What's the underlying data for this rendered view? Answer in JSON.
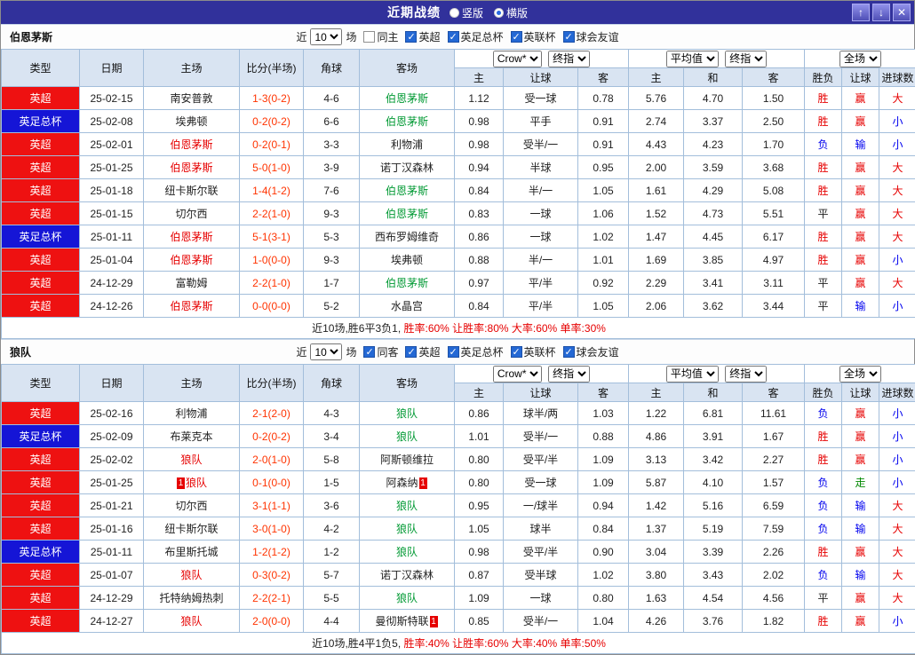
{
  "colors": {
    "topbar_bg": "#31319b",
    "header_cell_bg": "#d9e4f2",
    "grid_line": "#a3bedb",
    "league_epl_bg": "#ee1111",
    "league_facup_bg": "#1515d6",
    "score_text": "#ff3300",
    "win_text": "#e60000",
    "loss_text": "#0000ee",
    "push_text": "#008800",
    "focus_home": "#e60000",
    "focus_away": "#009933",
    "stat_red": "#e60000",
    "checkbox_blue": "#2468d4"
  },
  "topbar": {
    "title": "近期战绩",
    "vertical_label": "竖版",
    "horizontal_label": "横版",
    "selected_layout": "横版",
    "up_button": "↑",
    "down_button": "↓",
    "close_button": "✕"
  },
  "table_header": {
    "col_type": "类型",
    "col_date": "日期",
    "col_home": "主场",
    "col_score": "比分(半场)",
    "col_corner": "角球",
    "col_away": "客场",
    "sub_home": "主",
    "sub_handicap": "让球",
    "sub_away": "客",
    "sub_avg_home": "主",
    "sub_avg_draw": "和",
    "sub_avg_away": "客",
    "sub_result": "胜负",
    "sub_let": "让球",
    "sub_goals": "进球数",
    "dd_company": "Crow*",
    "dd_final1": "终指",
    "dd_avg": "平均值",
    "dd_final2": "终指",
    "dd_scope": "全场"
  },
  "sections": [
    {
      "team": "伯恩茅斯",
      "filter": {
        "near": "近",
        "count": "10",
        "unit": "场",
        "same_venue_label": "同主",
        "same_venue_checked": false,
        "leagues": [
          "英超",
          "英足总杯",
          "英联杯",
          "球会友谊"
        ]
      },
      "rows": [
        {
          "league": "英超",
          "date": "25-02-15",
          "home": "南安普敦",
          "score": "1-3(0-2)",
          "corner": "4-6",
          "away": "伯恩茅斯",
          "focus": "away",
          "odds": [
            "1.12",
            "受一球",
            "0.78"
          ],
          "avg": [
            "5.76",
            "4.70",
            "1.50"
          ],
          "result": "胜",
          "handicap": "赢",
          "goals": "大"
        },
        {
          "league": "英足总杯",
          "date": "25-02-08",
          "home": "埃弗顿",
          "score": "0-2(0-2)",
          "corner": "6-6",
          "away": "伯恩茅斯",
          "focus": "away",
          "odds": [
            "0.98",
            "平手",
            "0.91"
          ],
          "avg": [
            "2.74",
            "3.37",
            "2.50"
          ],
          "result": "胜",
          "handicap": "赢",
          "goals": "小"
        },
        {
          "league": "英超",
          "date": "25-02-01",
          "home": "伯恩茅斯",
          "focus": "home",
          "score": "0-2(0-1)",
          "corner": "3-3",
          "away": "利物浦",
          "odds": [
            "0.98",
            "受半/一",
            "0.91"
          ],
          "avg": [
            "4.43",
            "4.23",
            "1.70"
          ],
          "result": "负",
          "handicap": "输",
          "goals": "小"
        },
        {
          "league": "英超",
          "date": "25-01-25",
          "home": "伯恩茅斯",
          "focus": "home",
          "score": "5-0(1-0)",
          "corner": "3-9",
          "away": "诺丁汉森林",
          "odds": [
            "0.94",
            "半球",
            "0.95"
          ],
          "avg": [
            "2.00",
            "3.59",
            "3.68"
          ],
          "result": "胜",
          "handicap": "赢",
          "goals": "大"
        },
        {
          "league": "英超",
          "date": "25-01-18",
          "home": "纽卡斯尔联",
          "score": "1-4(1-2)",
          "corner": "7-6",
          "away": "伯恩茅斯",
          "focus": "away",
          "odds": [
            "0.84",
            "半/一",
            "1.05"
          ],
          "avg": [
            "1.61",
            "4.29",
            "5.08"
          ],
          "result": "胜",
          "handicap": "赢",
          "goals": "大"
        },
        {
          "league": "英超",
          "date": "25-01-15",
          "home": "切尔西",
          "score": "2-2(1-0)",
          "corner": "9-3",
          "away": "伯恩茅斯",
          "focus": "away",
          "odds": [
            "0.83",
            "一球",
            "1.06"
          ],
          "avg": [
            "1.52",
            "4.73",
            "5.51"
          ],
          "result": "平",
          "handicap": "赢",
          "goals": "大"
        },
        {
          "league": "英足总杯",
          "date": "25-01-11",
          "home": "伯恩茅斯",
          "focus": "home",
          "score": "5-1(3-1)",
          "corner": "5-3",
          "away": "西布罗姆维奇",
          "odds": [
            "0.86",
            "一球",
            "1.02"
          ],
          "avg": [
            "1.47",
            "4.45",
            "6.17"
          ],
          "result": "胜",
          "handicap": "赢",
          "goals": "大"
        },
        {
          "league": "英超",
          "date": "25-01-04",
          "home": "伯恩茅斯",
          "focus": "home",
          "score": "1-0(0-0)",
          "corner": "9-3",
          "away": "埃弗顿",
          "odds": [
            "0.88",
            "半/一",
            "1.01"
          ],
          "avg": [
            "1.69",
            "3.85",
            "4.97"
          ],
          "result": "胜",
          "handicap": "赢",
          "goals": "小"
        },
        {
          "league": "英超",
          "date": "24-12-29",
          "home": "富勒姆",
          "score": "2-2(1-0)",
          "corner": "1-7",
          "away": "伯恩茅斯",
          "focus": "away",
          "odds": [
            "0.97",
            "平/半",
            "0.92"
          ],
          "avg": [
            "2.29",
            "3.41",
            "3.11"
          ],
          "result": "平",
          "handicap": "赢",
          "goals": "大"
        },
        {
          "league": "英超",
          "date": "24-12-26",
          "home": "伯恩茅斯",
          "focus": "home",
          "score": "0-0(0-0)",
          "corner": "5-2",
          "away": "水晶宫",
          "odds": [
            "0.84",
            "平/半",
            "1.05"
          ],
          "avg": [
            "2.06",
            "3.62",
            "3.44"
          ],
          "result": "平",
          "handicap": "输",
          "goals": "小"
        }
      ],
      "summary": {
        "prefix": "近10场,胜6平3负1, ",
        "stats_text": "胜率:60% 让胜率:80% 大率:60% 单率:30%"
      }
    },
    {
      "team": "狼队",
      "filter": {
        "near": "近",
        "count": "10",
        "unit": "场",
        "same_venue_label": "同客",
        "same_venue_checked": true,
        "leagues": [
          "英超",
          "英足总杯",
          "英联杯",
          "球会友谊"
        ]
      },
      "rows": [
        {
          "league": "英超",
          "date": "25-02-16",
          "home": "利物浦",
          "score": "2-1(2-0)",
          "corner": "4-3",
          "away": "狼队",
          "focus": "away",
          "odds": [
            "0.86",
            "球半/两",
            "1.03"
          ],
          "avg": [
            "1.22",
            "6.81",
            "11.61"
          ],
          "result": "负",
          "handicap": "赢",
          "goals": "小"
        },
        {
          "league": "英足总杯",
          "date": "25-02-09",
          "home": "布莱克本",
          "score": "0-2(0-2)",
          "corner": "3-4",
          "away": "狼队",
          "focus": "away",
          "odds": [
            "1.01",
            "受半/一",
            "0.88"
          ],
          "avg": [
            "4.86",
            "3.91",
            "1.67"
          ],
          "result": "胜",
          "handicap": "赢",
          "goals": "小"
        },
        {
          "league": "英超",
          "date": "25-02-02",
          "home": "狼队",
          "focus": "home",
          "score": "2-0(1-0)",
          "corner": "5-8",
          "away": "阿斯顿维拉",
          "odds": [
            "0.80",
            "受平/半",
            "1.09"
          ],
          "avg": [
            "3.13",
            "3.42",
            "2.27"
          ],
          "result": "胜",
          "handicap": "赢",
          "goals": "小"
        },
        {
          "league": "英超",
          "date": "25-01-25",
          "home": "狼队",
          "focus": "home",
          "home_red": "1",
          "score": "0-1(0-0)",
          "corner": "1-5",
          "away": "阿森纳",
          "away_red": "1",
          "odds": [
            "0.80",
            "受一球",
            "1.09"
          ],
          "avg": [
            "5.87",
            "4.10",
            "1.57"
          ],
          "result": "负",
          "handicap": "走",
          "goals": "小"
        },
        {
          "league": "英超",
          "date": "25-01-21",
          "home": "切尔西",
          "score": "3-1(1-1)",
          "corner": "3-6",
          "away": "狼队",
          "focus": "away",
          "odds": [
            "0.95",
            "一/球半",
            "0.94"
          ],
          "avg": [
            "1.42",
            "5.16",
            "6.59"
          ],
          "result": "负",
          "handicap": "输",
          "goals": "大"
        },
        {
          "league": "英超",
          "date": "25-01-16",
          "home": "纽卡斯尔联",
          "score": "3-0(1-0)",
          "corner": "4-2",
          "away": "狼队",
          "focus": "away",
          "odds": [
            "1.05",
            "球半",
            "0.84"
          ],
          "avg": [
            "1.37",
            "5.19",
            "7.59"
          ],
          "result": "负",
          "handicap": "输",
          "goals": "大"
        },
        {
          "league": "英足总杯",
          "date": "25-01-11",
          "home": "布里斯托城",
          "score": "1-2(1-2)",
          "corner": "1-2",
          "away": "狼队",
          "focus": "away",
          "odds": [
            "0.98",
            "受平/半",
            "0.90"
          ],
          "avg": [
            "3.04",
            "3.39",
            "2.26"
          ],
          "result": "胜",
          "handicap": "赢",
          "goals": "大"
        },
        {
          "league": "英超",
          "date": "25-01-07",
          "home": "狼队",
          "focus": "home",
          "score": "0-3(0-2)",
          "corner": "5-7",
          "away": "诺丁汉森林",
          "odds": [
            "0.87",
            "受半球",
            "1.02"
          ],
          "avg": [
            "3.80",
            "3.43",
            "2.02"
          ],
          "result": "负",
          "handicap": "输",
          "goals": "大"
        },
        {
          "league": "英超",
          "date": "24-12-29",
          "home": "托特纳姆热刺",
          "score": "2-2(2-1)",
          "corner": "5-5",
          "away": "狼队",
          "focus": "away",
          "odds": [
            "1.09",
            "一球",
            "0.80"
          ],
          "avg": [
            "1.63",
            "4.54",
            "4.56"
          ],
          "result": "平",
          "handicap": "赢",
          "goals": "大"
        },
        {
          "league": "英超",
          "date": "24-12-27",
          "home": "狼队",
          "focus": "home",
          "score": "2-0(0-0)",
          "corner": "4-4",
          "away": "曼彻斯特联",
          "away_red": "1",
          "odds": [
            "0.85",
            "受半/一",
            "1.04"
          ],
          "avg": [
            "4.26",
            "3.76",
            "1.82"
          ],
          "result": "胜",
          "handicap": "赢",
          "goals": "小"
        }
      ],
      "summary": {
        "prefix": "近10场,胜4平1负5, ",
        "stats_text": "胜率:40% 让胜率:60% 大率:40% 单率:50%"
      }
    }
  ]
}
